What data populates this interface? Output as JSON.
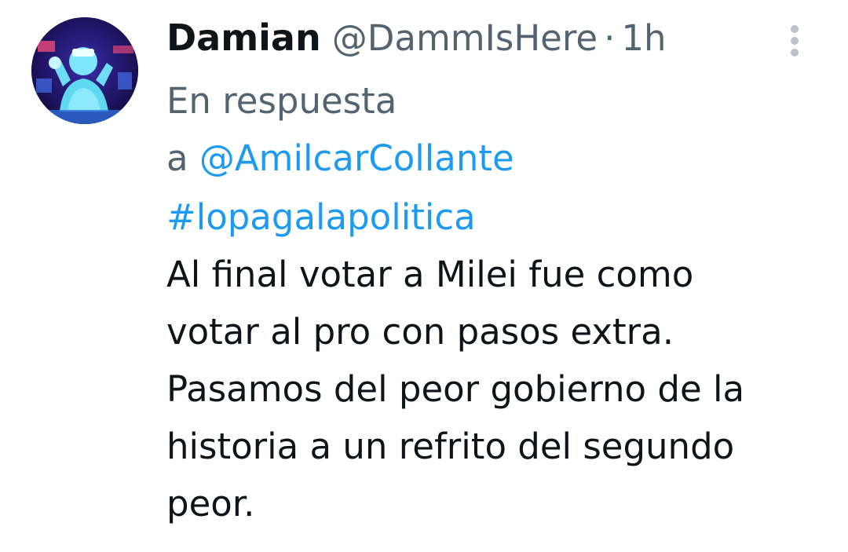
{
  "author": {
    "display_name": "Damian",
    "handle": "@DammIsHere",
    "separator": "·",
    "time": "1h",
    "avatar_icon": "profile-avatar"
  },
  "more_icon": "more-vertical-icon",
  "reply_context": {
    "prefix_line1": "En respuesta",
    "prefix_line2": "a",
    "mention": "@AmilcarCollante"
  },
  "tweet": {
    "hashtag": "#lopagalapolitica",
    "lines": [
      "Al final votar a Milei fue como",
      "votar al pro con pasos extra.",
      "Pasamos del peor gobierno de la",
      "historia a un refrito del segundo",
      "peor."
    ]
  },
  "colors": {
    "text": "#0f1419",
    "secondary": "#536471",
    "link": "#1d9bf0"
  }
}
